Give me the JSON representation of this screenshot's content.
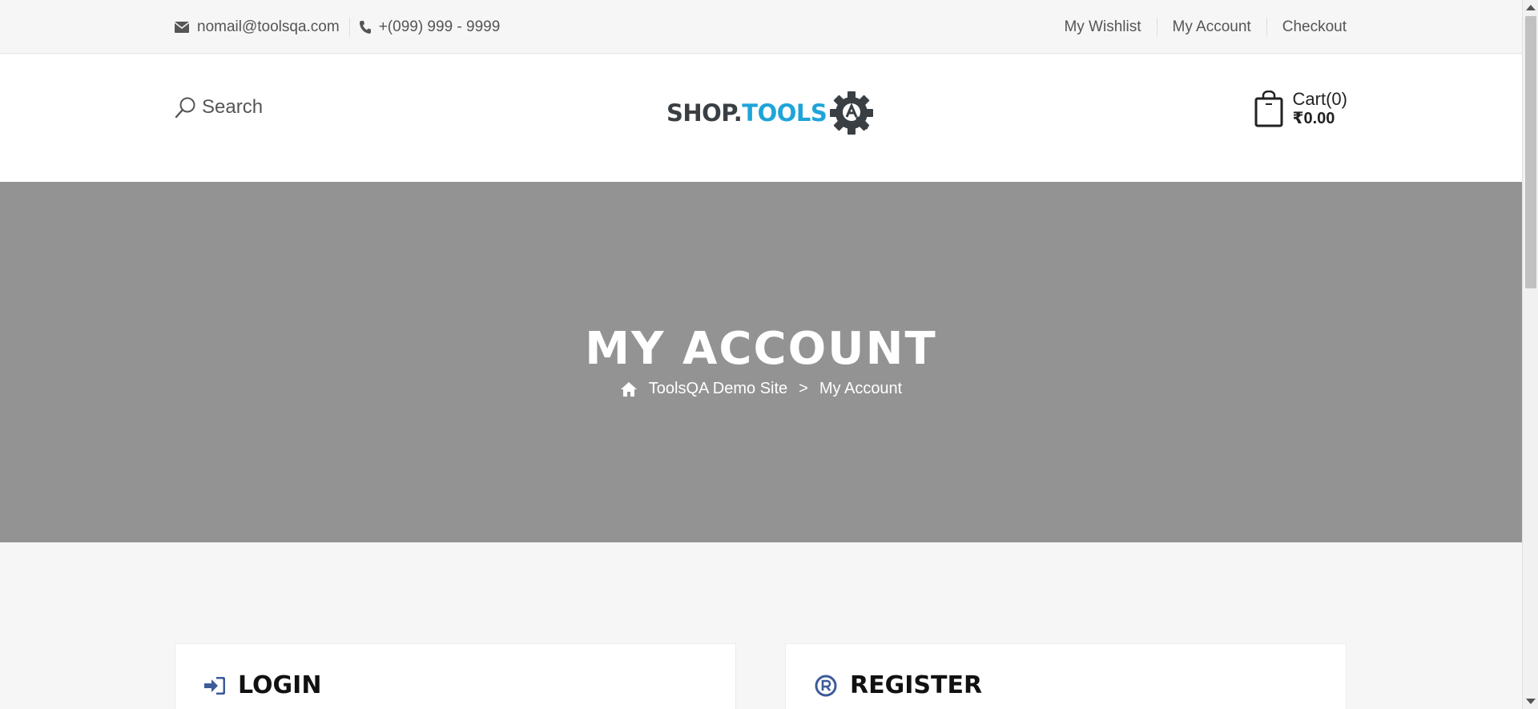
{
  "topbar": {
    "email": "nomail@toolsqa.com",
    "phone": "+(099) 999 - 9999",
    "links": [
      "My Wishlist",
      "My Account",
      "Checkout"
    ]
  },
  "header": {
    "search_label": "Search",
    "logo": {
      "shop": "SHOP",
      "dot": ".",
      "tools": "TOOLS"
    },
    "cart": {
      "label": "Cart(0)",
      "amount": "₹0.00"
    }
  },
  "banner": {
    "title": "MY ACCOUNT",
    "breadcrumb": {
      "home": "ToolsQA Demo Site",
      "separator": ">",
      "current": "My Account"
    }
  },
  "panels": {
    "login": "LOGIN",
    "register": "REGISTER"
  },
  "colors": {
    "accent_blue": "#1fa4d8",
    "icon_blue": "#3d5b9a",
    "banner_gray": "#939393"
  }
}
